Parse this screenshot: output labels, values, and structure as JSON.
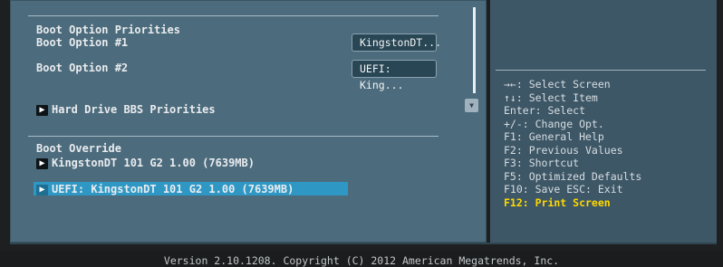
{
  "boot": {
    "section_title": "Boot Option Priorities",
    "option1_label": "Boot Option #1",
    "option1_value": "KingstonDT...",
    "option2_label": "Boot Option #2",
    "option2_value": "UEFI: King...",
    "hdd_bbs_label": "Hard Drive BBS Priorities",
    "override_title": "Boot Override",
    "override_items": [
      "KingstonDT 101 G2 1.00  (7639MB)",
      "UEFI: KingstonDT 101 G2 1.00  (7639MB)"
    ],
    "selected_index": 1
  },
  "help": {
    "items": [
      "→←: Select Screen",
      "↑↓: Select Item",
      "Enter: Select",
      "+/-: Change Opt.",
      "F1: General Help",
      "F2: Previous Values",
      "F3: Shortcut",
      "F5: Optimized Defaults",
      "F10: Save  ESC: Exit"
    ],
    "highlight_item": "F12: Print Screen"
  },
  "icons": {
    "submenu": "▶",
    "scroll_down": "▼"
  },
  "colors": {
    "panel_left": "#4c6b7c",
    "panel_right": "#3e5766",
    "selection": "#2e97c4",
    "highlight_text": "#ffd800"
  },
  "footer": {
    "version_text": "Version 2.10.1208. Copyright (C) 2012 American Megatrends, Inc."
  }
}
